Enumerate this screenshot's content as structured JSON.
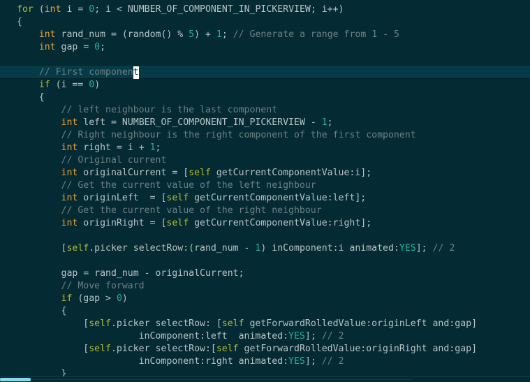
{
  "editor": {
    "title": "Objective-C source code editor",
    "language": "Objective-C",
    "theme": {
      "background": "#042a33",
      "active_line_background": "#053a46",
      "foreground": "#b9c4c6",
      "keyword": "#b3bb34",
      "type": "#e8a33d",
      "number": "#23b3a0",
      "comment": "#6d8085",
      "cursor": "#ffffff"
    },
    "cursor": {
      "line_index": 4,
      "character": "t",
      "after_text": "// First component"
    },
    "scrollbar": {
      "orientation": "horizontal",
      "thumb_label": "horizontal-scroll-thumb"
    }
  },
  "code": {
    "lines": [
      {
        "active": false,
        "tokens": [
          {
            "t": "for",
            "c": "kw"
          },
          {
            "t": " (",
            "c": "punct"
          },
          {
            "t": "int",
            "c": "type"
          },
          {
            "t": " i = ",
            "c": "plain"
          },
          {
            "t": "0",
            "c": "num"
          },
          {
            "t": "; i < NUMBER_OF_COMPONENT_IN_PICKERVIEW; i++)",
            "c": "plain"
          }
        ]
      },
      {
        "active": false,
        "tokens": [
          {
            "t": "{",
            "c": "punct"
          }
        ]
      },
      {
        "active": false,
        "tokens": [
          {
            "t": "    ",
            "c": "plain"
          },
          {
            "t": "int",
            "c": "type"
          },
          {
            "t": " rand_num = (random() % ",
            "c": "plain"
          },
          {
            "t": "5",
            "c": "num"
          },
          {
            "t": ") + ",
            "c": "plain"
          },
          {
            "t": "1",
            "c": "num"
          },
          {
            "t": "; ",
            "c": "plain"
          },
          {
            "t": "// Generate a range from 1 - 5",
            "c": "comment"
          }
        ]
      },
      {
        "active": false,
        "tokens": [
          {
            "t": "    ",
            "c": "plain"
          },
          {
            "t": "int",
            "c": "type"
          },
          {
            "t": " gap = ",
            "c": "plain"
          },
          {
            "t": "0",
            "c": "num"
          },
          {
            "t": ";",
            "c": "plain"
          }
        ]
      },
      {
        "active": false,
        "tokens": []
      },
      {
        "active": true,
        "tokens": [
          {
            "t": "    ",
            "c": "plain"
          },
          {
            "t": "// First componen",
            "c": "comment"
          },
          {
            "t": "t",
            "c": "cursor"
          }
        ]
      },
      {
        "active": false,
        "tokens": [
          {
            "t": "    ",
            "c": "plain"
          },
          {
            "t": "if",
            "c": "kw"
          },
          {
            "t": " (i == ",
            "c": "plain"
          },
          {
            "t": "0",
            "c": "num"
          },
          {
            "t": ")",
            "c": "plain"
          }
        ]
      },
      {
        "active": false,
        "tokens": [
          {
            "t": "    {",
            "c": "punct"
          }
        ]
      },
      {
        "active": false,
        "tokens": [
          {
            "t": "        ",
            "c": "plain"
          },
          {
            "t": "// left neighbour is the last component",
            "c": "comment"
          }
        ]
      },
      {
        "active": false,
        "tokens": [
          {
            "t": "        ",
            "c": "plain"
          },
          {
            "t": "int",
            "c": "type"
          },
          {
            "t": " left = NUMBER_OF_COMPONENT_IN_PICKERVIEW - ",
            "c": "plain"
          },
          {
            "t": "1",
            "c": "num"
          },
          {
            "t": ";",
            "c": "plain"
          }
        ]
      },
      {
        "active": false,
        "tokens": [
          {
            "t": "        ",
            "c": "plain"
          },
          {
            "t": "// Right neighbour is the right component of the first component",
            "c": "comment"
          }
        ]
      },
      {
        "active": false,
        "tokens": [
          {
            "t": "        ",
            "c": "plain"
          },
          {
            "t": "int",
            "c": "type"
          },
          {
            "t": " right = i + ",
            "c": "plain"
          },
          {
            "t": "1",
            "c": "num"
          },
          {
            "t": ";",
            "c": "plain"
          }
        ]
      },
      {
        "active": false,
        "tokens": [
          {
            "t": "        ",
            "c": "plain"
          },
          {
            "t": "// Original current",
            "c": "comment"
          }
        ]
      },
      {
        "active": false,
        "tokens": [
          {
            "t": "        ",
            "c": "plain"
          },
          {
            "t": "int",
            "c": "type"
          },
          {
            "t": " originalCurrent = [",
            "c": "plain"
          },
          {
            "t": "self",
            "c": "kw"
          },
          {
            "t": " getCurrentComponentValue:i];",
            "c": "plain"
          }
        ]
      },
      {
        "active": false,
        "tokens": [
          {
            "t": "        ",
            "c": "plain"
          },
          {
            "t": "// Get the current value of the left neighbour",
            "c": "comment"
          }
        ]
      },
      {
        "active": false,
        "tokens": [
          {
            "t": "        ",
            "c": "plain"
          },
          {
            "t": "int",
            "c": "type"
          },
          {
            "t": " originLeft  = [",
            "c": "plain"
          },
          {
            "t": "self",
            "c": "kw"
          },
          {
            "t": " getCurrentComponentValue:left];",
            "c": "plain"
          }
        ]
      },
      {
        "active": false,
        "tokens": [
          {
            "t": "        ",
            "c": "plain"
          },
          {
            "t": "// Get the current value of the right neighbour",
            "c": "comment"
          }
        ]
      },
      {
        "active": false,
        "tokens": [
          {
            "t": "        ",
            "c": "plain"
          },
          {
            "t": "int",
            "c": "type"
          },
          {
            "t": " originRight = [",
            "c": "plain"
          },
          {
            "t": "self",
            "c": "kw"
          },
          {
            "t": " getCurrentComponentValue:right];",
            "c": "plain"
          }
        ]
      },
      {
        "active": false,
        "tokens": []
      },
      {
        "active": false,
        "tokens": [
          {
            "t": "        [",
            "c": "plain"
          },
          {
            "t": "self",
            "c": "kw"
          },
          {
            "t": ".picker selectRow:(rand_num - ",
            "c": "plain"
          },
          {
            "t": "1",
            "c": "num"
          },
          {
            "t": ") inComponent:i animated:",
            "c": "plain"
          },
          {
            "t": "YES",
            "c": "const"
          },
          {
            "t": "]; ",
            "c": "plain"
          },
          {
            "t": "// 2",
            "c": "comment"
          }
        ]
      },
      {
        "active": false,
        "tokens": []
      },
      {
        "active": false,
        "tokens": [
          {
            "t": "        gap = rand_num - originalCurrent;",
            "c": "plain"
          }
        ]
      },
      {
        "active": false,
        "tokens": [
          {
            "t": "        ",
            "c": "plain"
          },
          {
            "t": "// Move forward",
            "c": "comment"
          }
        ]
      },
      {
        "active": false,
        "tokens": [
          {
            "t": "        ",
            "c": "plain"
          },
          {
            "t": "if",
            "c": "kw"
          },
          {
            "t": " (gap > ",
            "c": "plain"
          },
          {
            "t": "0",
            "c": "num"
          },
          {
            "t": ")",
            "c": "plain"
          }
        ]
      },
      {
        "active": false,
        "tokens": [
          {
            "t": "        {",
            "c": "punct"
          }
        ]
      },
      {
        "active": false,
        "tokens": [
          {
            "t": "            [",
            "c": "plain"
          },
          {
            "t": "self",
            "c": "kw"
          },
          {
            "t": ".picker selectRow: [",
            "c": "plain"
          },
          {
            "t": "self",
            "c": "kw"
          },
          {
            "t": " getForwardRolledValue:originLeft and:gap]",
            "c": "plain"
          }
        ]
      },
      {
        "active": false,
        "tokens": [
          {
            "t": "                      inComponent:left  animated:",
            "c": "plain"
          },
          {
            "t": "YES",
            "c": "const"
          },
          {
            "t": "]; ",
            "c": "plain"
          },
          {
            "t": "// 2",
            "c": "comment"
          }
        ]
      },
      {
        "active": false,
        "tokens": [
          {
            "t": "            [",
            "c": "plain"
          },
          {
            "t": "self",
            "c": "kw"
          },
          {
            "t": ".picker selectRow:[",
            "c": "plain"
          },
          {
            "t": "self",
            "c": "kw"
          },
          {
            "t": " getForwardRolledValue:originRight and:gap]",
            "c": "plain"
          }
        ]
      },
      {
        "active": false,
        "tokens": [
          {
            "t": "                      inComponent:right animated:",
            "c": "plain"
          },
          {
            "t": "YES",
            "c": "const"
          },
          {
            "t": "]; ",
            "c": "plain"
          },
          {
            "t": "// 2",
            "c": "comment"
          }
        ]
      },
      {
        "active": false,
        "tokens": [
          {
            "t": "        }",
            "c": "punct"
          }
        ]
      }
    ]
  }
}
